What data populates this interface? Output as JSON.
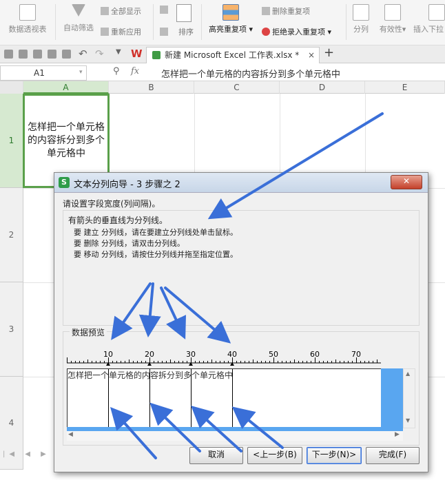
{
  "ribbon": {
    "pivot": "数据透视表",
    "autofilter": "自动筛选",
    "show_all": "全部显示",
    "reapply": "重新应用",
    "sort": "排序",
    "highlight_dup": "高亮重复项",
    "delete_dup": "删除重复项",
    "reject_dup": "拒绝录入重复项",
    "split_col": "分列",
    "validity": "有效性",
    "insert_dropdown": "插入下拉"
  },
  "tabs": {
    "file_title": "新建 Microsoft Excel 工作表.xlsx *",
    "close": "×",
    "add": "+"
  },
  "formula": {
    "cell_ref": "A1",
    "fx": "fx",
    "content": "怎样把一个单元格的内容拆分到多个单元格中"
  },
  "columns": [
    "A",
    "B",
    "C",
    "D",
    "E"
  ],
  "rows": [
    "1",
    "2",
    "3",
    "4"
  ],
  "cell_a1": "怎样把一个单元格的内容拆分到多个单元格中",
  "dialog": {
    "title": "文本分列向导 - 3 步骤之 2",
    "close": "✕",
    "instruction": "请设置字段宽度(列间隔)。",
    "help_title": "有箭头的垂直线为分列线。",
    "help_lines": [
      "要 建立 分列线，请在要建立分列线处单击鼠标。",
      "要 删除 分列线，请双击分列线。",
      "要 移动 分列线，请按住分列线并拖至指定位置。"
    ],
    "preview_label": "数据预览",
    "ruler_labels": [
      "10",
      "20",
      "30",
      "40",
      "50",
      "60",
      "70"
    ],
    "preview_segments": [
      "怎样把一个",
      "单元格的内",
      "容拆分到多",
      "个单元格中"
    ],
    "buttons": {
      "cancel": "取消",
      "prev": "<上一步(B)",
      "next": "下一步(N)>",
      "finish": "完成(F)"
    }
  },
  "colors": {
    "accent_blue": "#3a6fd8",
    "selection_green": "#5aa04a",
    "preview_blue": "#59a6f0"
  }
}
